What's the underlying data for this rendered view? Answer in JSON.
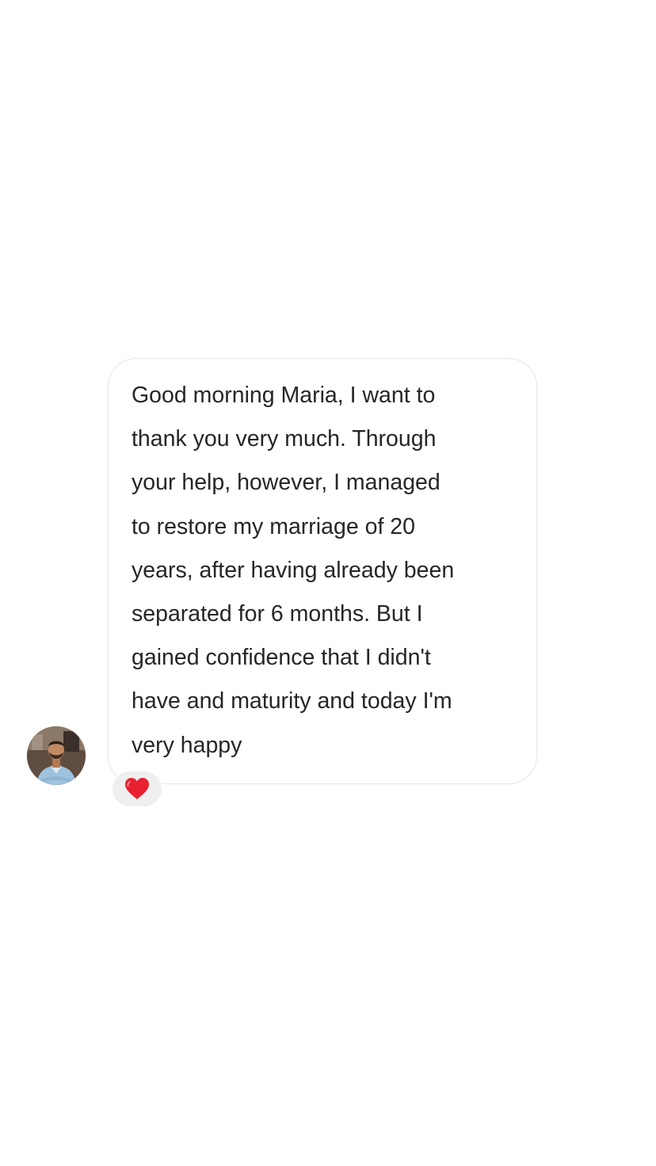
{
  "conversation": {
    "message": {
      "text": "Good morning Maria, I want to\nthank you very much. Through\nyour help, however, I managed\nto restore my marriage of 20\nyears, after having already been\nseparated for 6 months. But I\ngained confidence that I didn't\nhave and maturity and today I'm\nvery happy",
      "reaction": "heart-icon",
      "reaction_color": "#e8202f",
      "sender_avatar": "profile-photo"
    }
  },
  "colors": {
    "background": "#ffffff",
    "bubble_border": "#e6e6e6",
    "text": "#262626",
    "reaction_pill": "#efefef"
  }
}
